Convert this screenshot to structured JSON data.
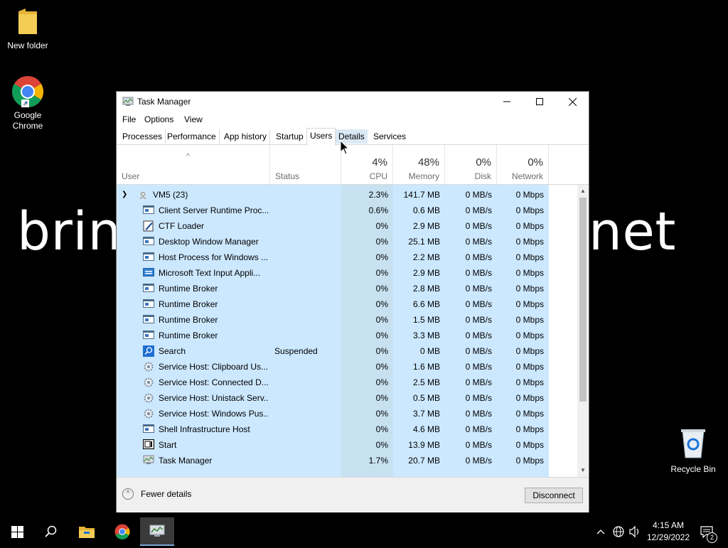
{
  "desktop": {
    "bg_text_left": "brin",
    "bg_text_right": "net",
    "icons": [
      {
        "label": "New folder"
      },
      {
        "label": "Google\nChrome"
      },
      {
        "label": "Recycle Bin"
      }
    ]
  },
  "window": {
    "title": "Task Manager",
    "menu": [
      "File",
      "Options",
      "View"
    ],
    "tabs": [
      "Processes",
      "Performance",
      "App history",
      "Startup",
      "Users",
      "Details",
      "Services"
    ],
    "active_tab": "Users",
    "columns": {
      "user": "User",
      "status": "Status",
      "cpu": {
        "pct": "4%",
        "label": "CPU"
      },
      "memory": {
        "pct": "48%",
        "label": "Memory"
      },
      "disk": {
        "pct": "0%",
        "label": "Disk"
      },
      "network": {
        "pct": "0%",
        "label": "Network"
      }
    },
    "group": {
      "name": "VM5 (23)",
      "cpu": "2.3%",
      "memory": "141.7 MB",
      "disk": "0 MB/s",
      "network": "0 Mbps"
    },
    "rows": [
      {
        "name": "Client Server Runtime Proc...",
        "status": "",
        "cpu": "0.6%",
        "memory": "0.6 MB",
        "disk": "0 MB/s",
        "network": "0 Mbps",
        "icon": "window-icon"
      },
      {
        "name": "CTF Loader",
        "status": "",
        "cpu": "0%",
        "memory": "2.9 MB",
        "disk": "0 MB/s",
        "network": "0 Mbps",
        "icon": "pen-icon"
      },
      {
        "name": "Desktop Window Manager",
        "status": "",
        "cpu": "0%",
        "memory": "25.1 MB",
        "disk": "0 MB/s",
        "network": "0 Mbps",
        "icon": "window-icon"
      },
      {
        "name": "Host Process for Windows ...",
        "status": "",
        "cpu": "0%",
        "memory": "2.2 MB",
        "disk": "0 MB/s",
        "network": "0 Mbps",
        "icon": "window-icon"
      },
      {
        "name": "Microsoft Text Input Appli...",
        "status": "",
        "cpu": "0%",
        "memory": "2.9 MB",
        "disk": "0 MB/s",
        "network": "0 Mbps",
        "icon": "keyboard-icon"
      },
      {
        "name": "Runtime Broker",
        "status": "",
        "cpu": "0%",
        "memory": "2.8 MB",
        "disk": "0 MB/s",
        "network": "0 Mbps",
        "icon": "window-icon"
      },
      {
        "name": "Runtime Broker",
        "status": "",
        "cpu": "0%",
        "memory": "6.6 MB",
        "disk": "0 MB/s",
        "network": "0 Mbps",
        "icon": "window-icon"
      },
      {
        "name": "Runtime Broker",
        "status": "",
        "cpu": "0%",
        "memory": "1.5 MB",
        "disk": "0 MB/s",
        "network": "0 Mbps",
        "icon": "window-icon"
      },
      {
        "name": "Runtime Broker",
        "status": "",
        "cpu": "0%",
        "memory": "3.3 MB",
        "disk": "0 MB/s",
        "network": "0 Mbps",
        "icon": "window-icon"
      },
      {
        "name": "Search",
        "status": "Suspended",
        "cpu": "0%",
        "memory": "0 MB",
        "disk": "0 MB/s",
        "network": "0 Mbps",
        "icon": "search-icon"
      },
      {
        "name": "Service Host: Clipboard Us...",
        "status": "",
        "cpu": "0%",
        "memory": "1.6 MB",
        "disk": "0 MB/s",
        "network": "0 Mbps",
        "icon": "gear-icon"
      },
      {
        "name": "Service Host: Connected D...",
        "status": "",
        "cpu": "0%",
        "memory": "2.5 MB",
        "disk": "0 MB/s",
        "network": "0 Mbps",
        "icon": "gear-icon"
      },
      {
        "name": "Service Host: Unistack Serv...",
        "status": "",
        "cpu": "0%",
        "memory": "0.5 MB",
        "disk": "0 MB/s",
        "network": "0 Mbps",
        "icon": "gear-icon"
      },
      {
        "name": "Service Host: Windows Pus...",
        "status": "",
        "cpu": "0%",
        "memory": "3.7 MB",
        "disk": "0 MB/s",
        "network": "0 Mbps",
        "icon": "gear-icon"
      },
      {
        "name": "Shell Infrastructure Host",
        "status": "",
        "cpu": "0%",
        "memory": "4.6 MB",
        "disk": "0 MB/s",
        "network": "0 Mbps",
        "icon": "window-icon"
      },
      {
        "name": "Start",
        "status": "",
        "cpu": "0%",
        "memory": "13.9 MB",
        "disk": "0 MB/s",
        "network": "0 Mbps",
        "icon": "start-icon"
      },
      {
        "name": "Task Manager",
        "status": "",
        "cpu": "1.7%",
        "memory": "20.7 MB",
        "disk": "0 MB/s",
        "network": "0 Mbps",
        "icon": "task-manager-icon"
      }
    ],
    "fewer_details": "Fewer details",
    "disconnect": "Disconnect"
  },
  "tray": {
    "time": "4:15 AM",
    "date": "12/29/2022",
    "notifications": "2"
  },
  "colors": {
    "selection": "#cce8ff",
    "cpu_heat": "#d7ecf8",
    "window_bg": "#ffffff"
  }
}
